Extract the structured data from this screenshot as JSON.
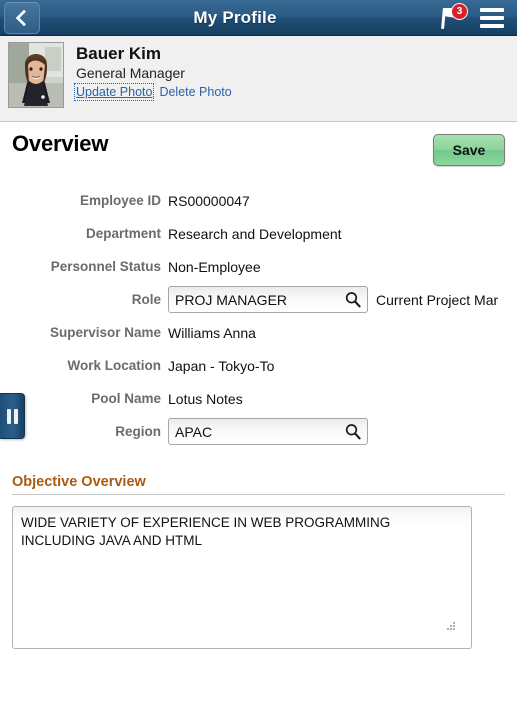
{
  "navbar": {
    "back_label": "Back",
    "title": "My Profile",
    "flag_icon": "flag-icon",
    "notification_count": "3",
    "menu_icon": "hamburger-menu-icon"
  },
  "person": {
    "avatar_alt": "employee-photo",
    "name": "Bauer Kim",
    "job_title": "General Manager",
    "update_photo_label": "Update Photo",
    "delete_photo_label": "Delete Photo"
  },
  "overview": {
    "heading": "Overview",
    "save_label": "Save"
  },
  "fields": [
    {
      "label": "Employee ID",
      "value": "RS00000047",
      "type": "text"
    },
    {
      "label": "Department",
      "value": "Research and Development",
      "type": "text"
    },
    {
      "label": "Personnel Status",
      "value": "Non-Employee",
      "type": "text"
    },
    {
      "label": "Role",
      "value": "PROJ MANAGER",
      "type": "lookup",
      "suffix": "Current Project Mar"
    },
    {
      "label": "Supervisor Name",
      "value": "Williams Anna",
      "type": "text"
    },
    {
      "label": "Work Location",
      "value": "Japan - Tokyo-To",
      "type": "text"
    },
    {
      "label": "Pool Name",
      "value": "Lotus Notes",
      "type": "text"
    },
    {
      "label": "Region",
      "value": "APAC",
      "type": "lookup",
      "suffix": ""
    }
  ],
  "field_labels": {
    "employee_id": "Employee ID",
    "department": "Department",
    "personnel_status": "Personnel Status",
    "role": "Role",
    "supervisor_name": "Supervisor Name",
    "work_location": "Work Location",
    "pool_name": "Pool Name",
    "region": "Region"
  },
  "field_values": {
    "employee_id": "RS00000047",
    "department": "Research and Development",
    "personnel_status": "Non-Employee",
    "role": "PROJ MANAGER",
    "role_suffix": "Current Project Mar",
    "supervisor_name": "Williams Anna",
    "work_location": "Japan - Tokyo-To",
    "pool_name": "Lotus Notes",
    "region": "APAC"
  },
  "objective": {
    "section_title": "Objective Overview",
    "text": "WIDE VARIETY OF EXPERIENCE IN WEB PROGRAMMING INCLUDING JAVA AND HTML"
  },
  "drawer": {
    "handle_icon": "pause-bars-handle-icon"
  },
  "colors": {
    "navbar_top": "#376a94",
    "navbar_bottom": "#17405f",
    "badge_red": "#d6202a",
    "save_green": "#8ed49c",
    "section_orange": "#ab5a13",
    "link_blue": "#2b63a8",
    "label_gray": "#6b6b6b"
  }
}
